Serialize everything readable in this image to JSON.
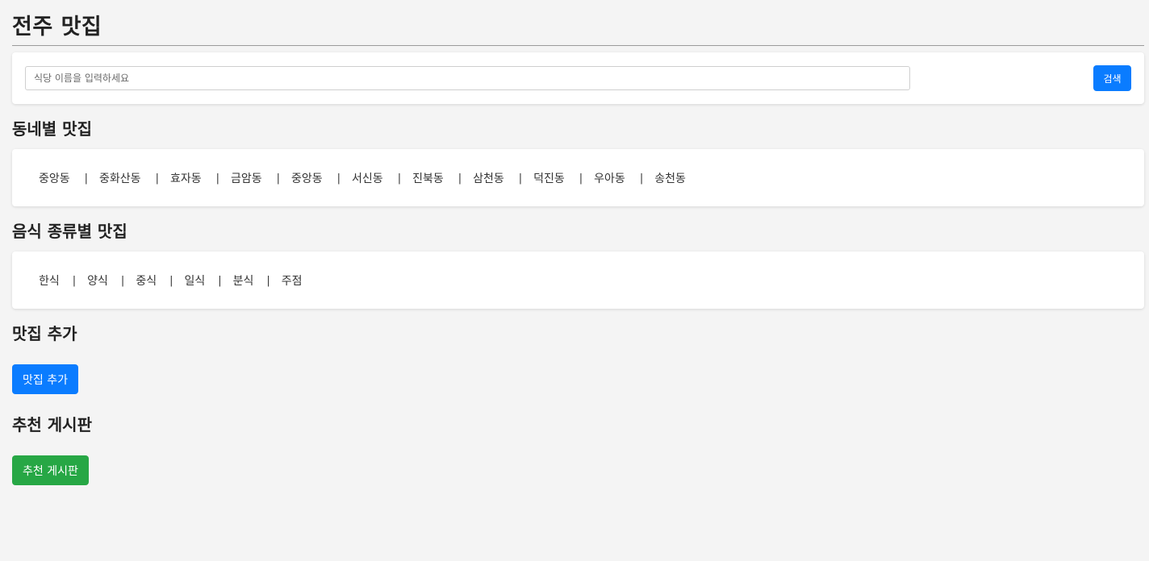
{
  "page": {
    "title": "전주 맛집"
  },
  "search": {
    "placeholder": "식당 이름을 입력하세요",
    "value": "",
    "button_label": "검색",
    "button_color": "#0a7cff"
  },
  "neighborhoods": {
    "title": "동네별 맛집",
    "items": [
      "중앙동",
      "중화산동",
      "효자동",
      "금암동",
      "중앙동",
      "서신동",
      "진북동",
      "삼천동",
      "덕진동",
      "우아동",
      "송천동"
    ],
    "separator": "|"
  },
  "food_types": {
    "title": "음식 종류별 맛집",
    "items": [
      "한식",
      "양식",
      "중식",
      "일식",
      "분식",
      "주점"
    ],
    "separator": "|"
  },
  "add_restaurant": {
    "title": "맛집 추가",
    "button_label": "맛집 추가",
    "button_color": "#0a7cff"
  },
  "board": {
    "title": "추천 게시판",
    "button_label": "추천 게시판",
    "button_color": "#27a745"
  }
}
